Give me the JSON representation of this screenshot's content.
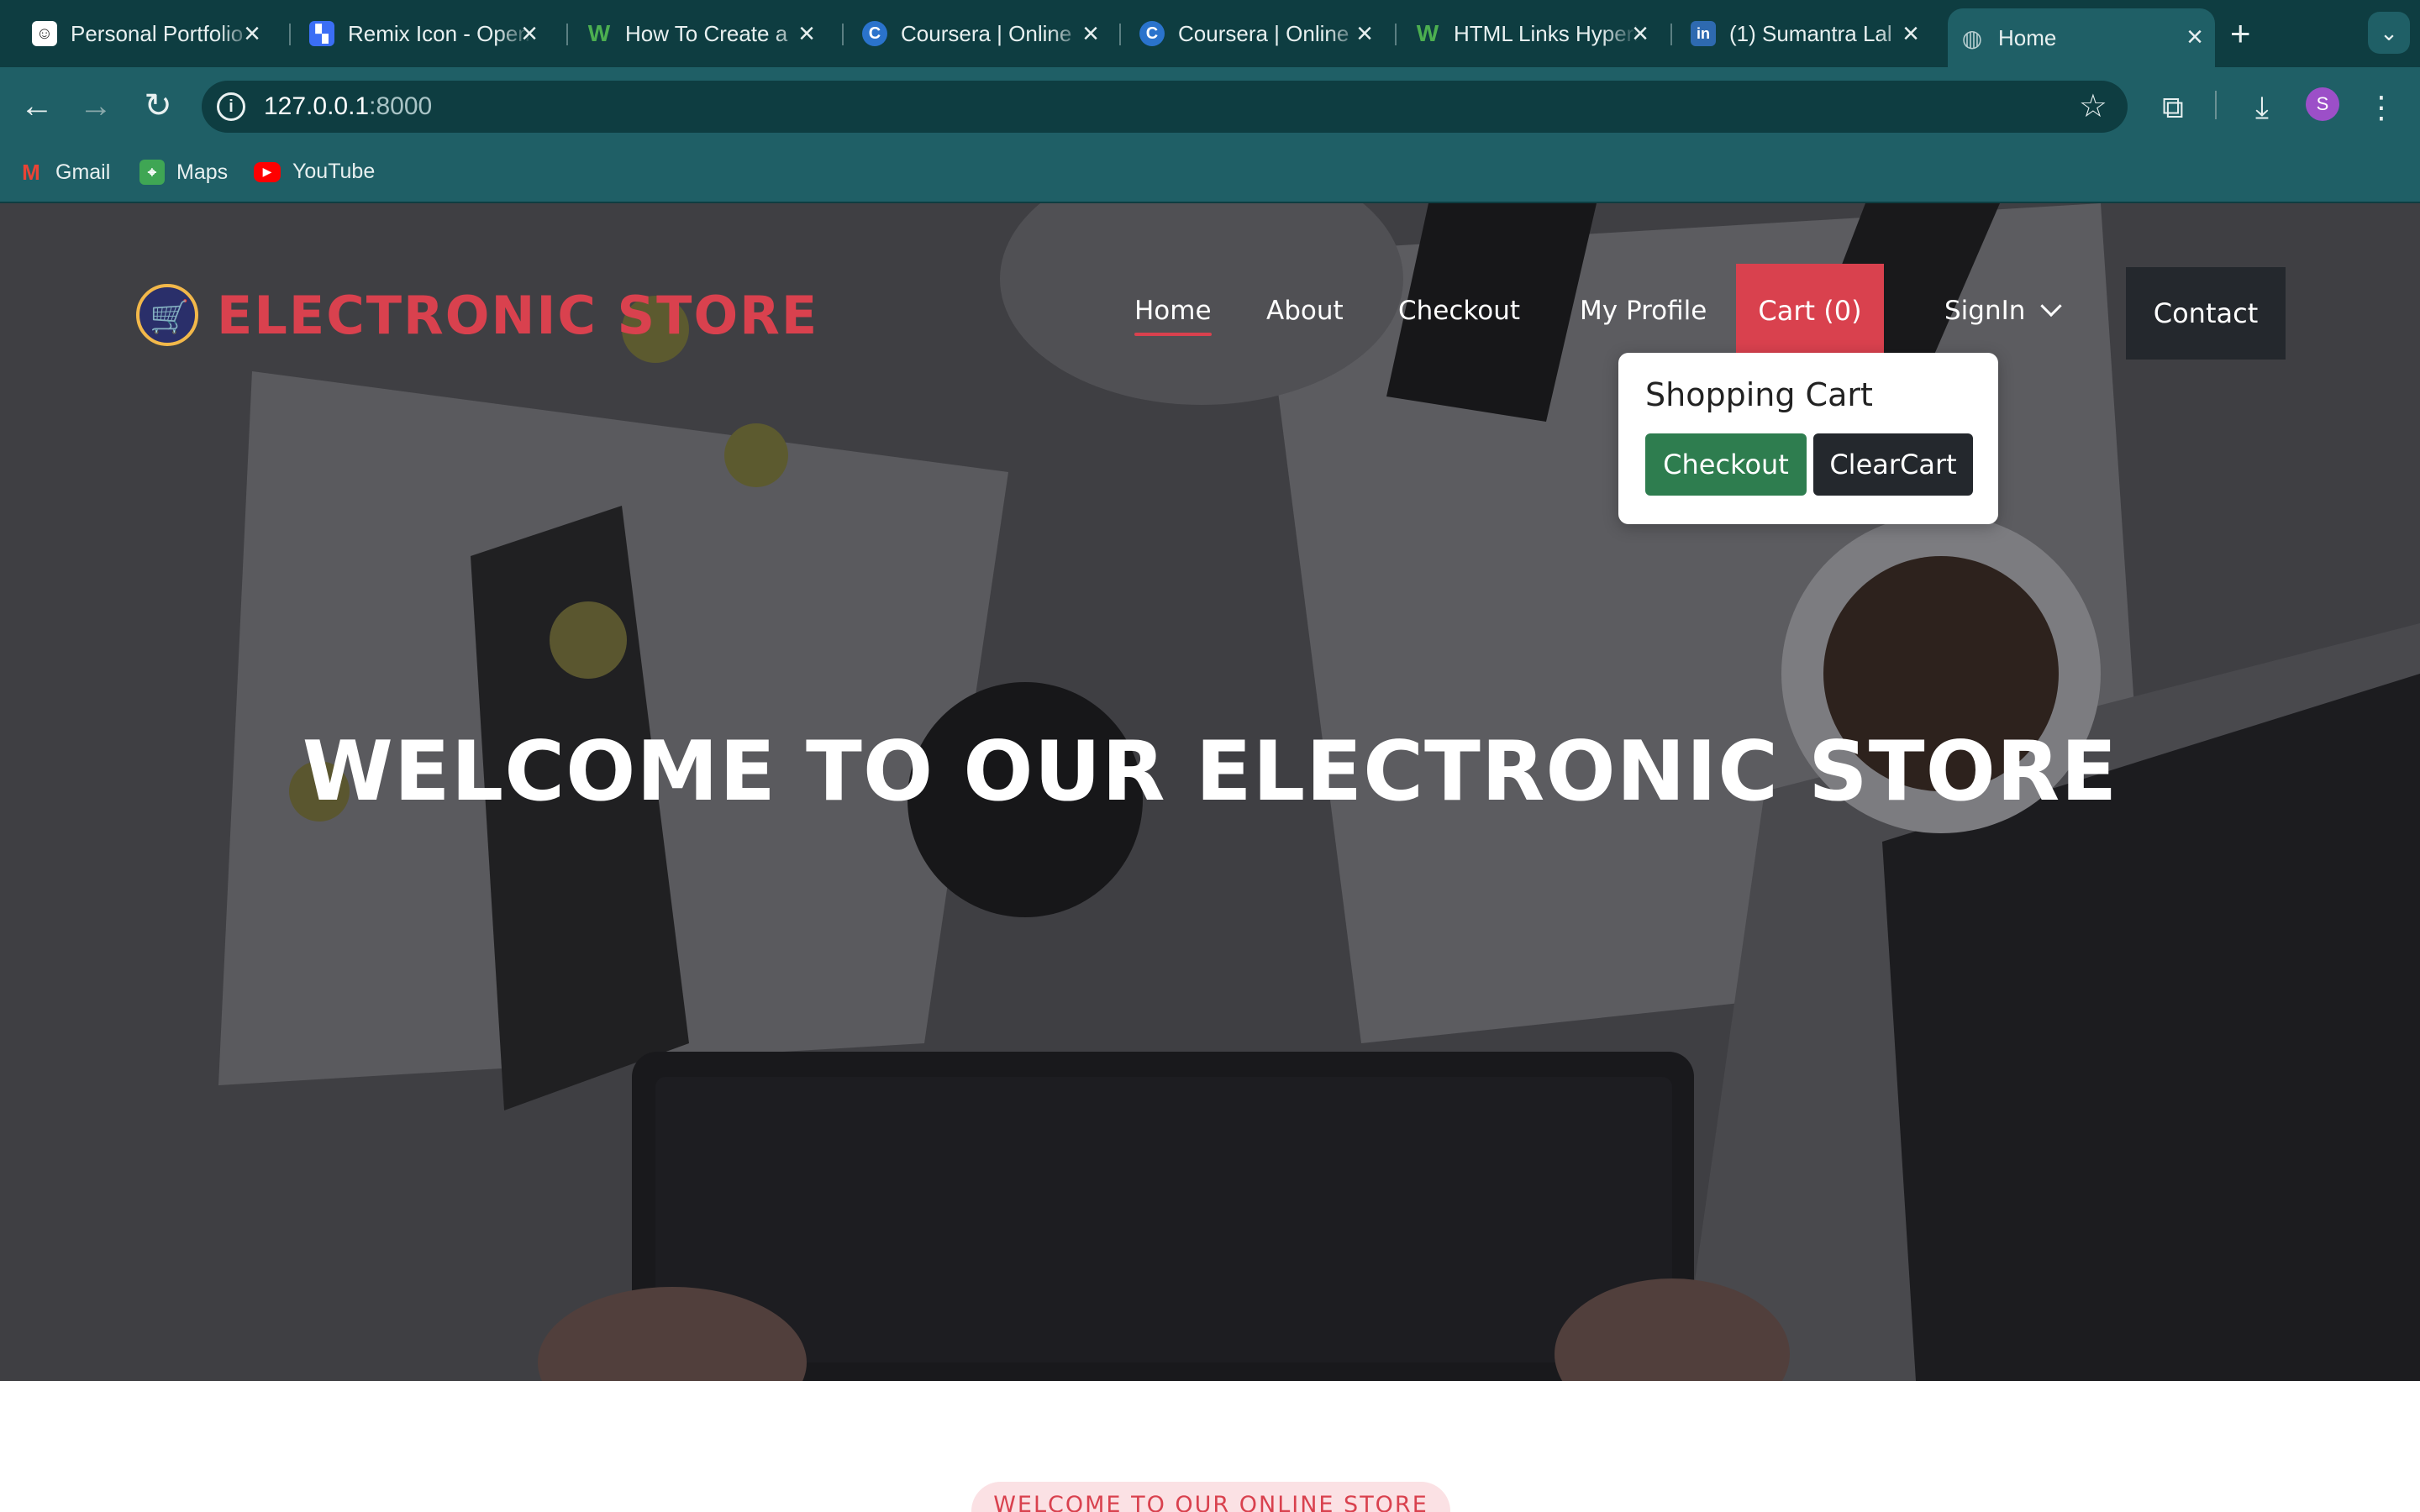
{
  "browser": {
    "tabs": [
      {
        "title": "Personal Portfolio",
        "favicon": "portfolio-favicon-icon"
      },
      {
        "title": "Remix Icon - Open source icon",
        "favicon": "remix-favicon-icon"
      },
      {
        "title": "How To Create a",
        "favicon": "w3-favicon-icon"
      },
      {
        "title": "Coursera | Online",
        "favicon": "coursera-favicon-icon"
      },
      {
        "title": "Coursera | Online",
        "favicon": "coursera-favicon-icon"
      },
      {
        "title": "HTML Links Hyperlinks",
        "favicon": "w3-favicon-icon"
      },
      {
        "title": "(1) Sumantra Lal",
        "favicon": "linkedin-favicon-icon"
      },
      {
        "title": "Home",
        "favicon": "globe-icon"
      }
    ],
    "url_host": "127.0.0.1",
    "url_port": ":8000",
    "bookmarks": [
      {
        "label": "Gmail"
      },
      {
        "label": "Maps"
      },
      {
        "label": "YouTube"
      }
    ],
    "profile_initial": "S"
  },
  "site": {
    "brand": "ELECTRONIC STORE",
    "nav": {
      "home": "Home",
      "about": "About",
      "checkout": "Checkout",
      "profile": "My Profile",
      "cart": "Cart (0)",
      "signin": "SignIn",
      "contact": "Contact"
    },
    "cart_popup": {
      "title": "Shopping Cart",
      "checkout_label": "Checkout",
      "clear_label": "ClearCart"
    },
    "hero_title": "WELCOME TO OUR ELECTRONIC STORE",
    "section_badge": "WELCOME TO OUR ONLINE STORE"
  },
  "colors": {
    "chrome_dark": "#0e3d41",
    "chrome_light": "#1f5f66",
    "accent_red": "#d9414e",
    "checkout_green": "#2e7d4f",
    "dark_button": "#24282d"
  }
}
